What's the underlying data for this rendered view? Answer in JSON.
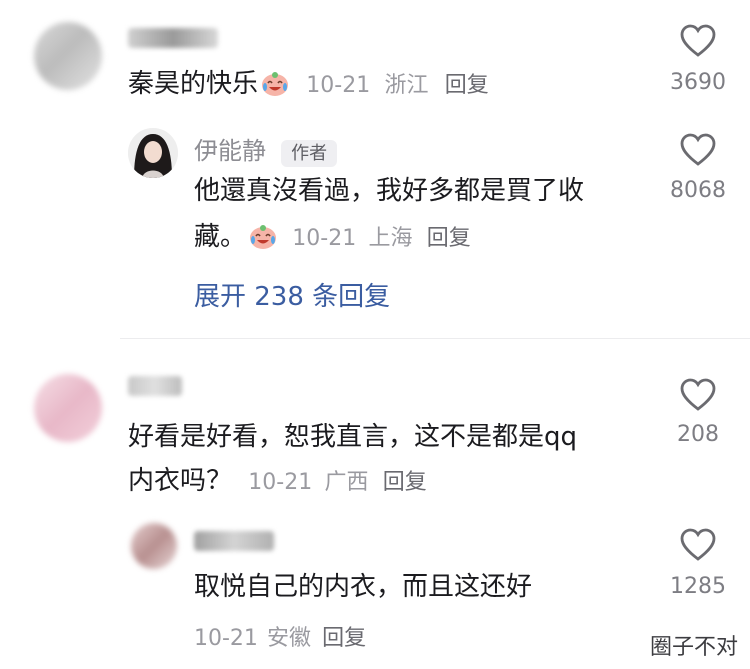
{
  "comments": [
    {
      "text": "秦昊的快乐",
      "date": "10-21",
      "location": "浙江",
      "reply_label": "回复",
      "likes": "3690"
    },
    {
      "author": "伊能静",
      "author_badge": "作者",
      "text_line1": "他還真沒看過，我好多都是買了收",
      "text_line2": "藏。",
      "date": "10-21",
      "location": "上海",
      "reply_label": "回复",
      "likes": "8068",
      "expand_label": "展开 238 条回复"
    },
    {
      "text_line1": "好看是好看，恕我直言，这不是都是qq",
      "text_line2": "内衣吗？",
      "date": "10-21",
      "location": "广西",
      "reply_label": "回复",
      "likes": "208"
    },
    {
      "text": "取悦自己的内衣，而且这还好",
      "date": "10-21",
      "location": "安徽",
      "reply_label": "回复",
      "likes": "1285"
    }
  ],
  "icons": {
    "like": "heart-outline-icon",
    "emoji": "crying-laughing-face-emoji"
  },
  "watermark": "圈子不对",
  "colors": {
    "meta": "#9a9aa0",
    "link": "#3b5da1",
    "badge_bg": "#efeff2"
  }
}
